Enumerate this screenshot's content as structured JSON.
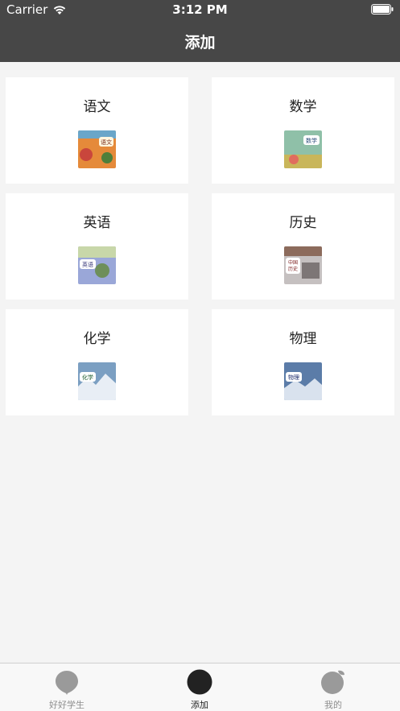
{
  "status_bar": {
    "carrier": "Carrier",
    "time": "3:12 PM"
  },
  "nav": {
    "title": "添加"
  },
  "subjects": [
    {
      "title": "语文",
      "cover_icon": "chinese-book-cover",
      "cover_text": "语文",
      "cover_color": "#e58a3a"
    },
    {
      "title": "数学",
      "cover_icon": "math-book-cover",
      "cover_text": "数学",
      "cover_color": "#8fc0a8"
    },
    {
      "title": "英语",
      "cover_icon": "english-book-cover",
      "cover_text": "英语",
      "cover_color": "#9aa7d8"
    },
    {
      "title": "历史",
      "cover_icon": "history-book-cover",
      "cover_text": "中国历史",
      "cover_color": "#c5c0c0"
    },
    {
      "title": "化学",
      "cover_icon": "chemistry-book-cover",
      "cover_text": "化学",
      "cover_color": "#7b9fc2"
    },
    {
      "title": "物理",
      "cover_icon": "physics-book-cover",
      "cover_text": "物理",
      "cover_color": "#5b7ca8"
    }
  ],
  "tabs": [
    {
      "label": "好好学生",
      "icon": "balloon-icon",
      "active": false
    },
    {
      "label": "添加",
      "icon": "circle-icon",
      "active": true
    },
    {
      "label": "我的",
      "icon": "apple-icon",
      "active": false
    }
  ],
  "colors": {
    "nav_background": "#474747",
    "page_background": "#f4f4f4",
    "tab_active": "#222222",
    "tab_inactive": "#8e8e8e"
  }
}
